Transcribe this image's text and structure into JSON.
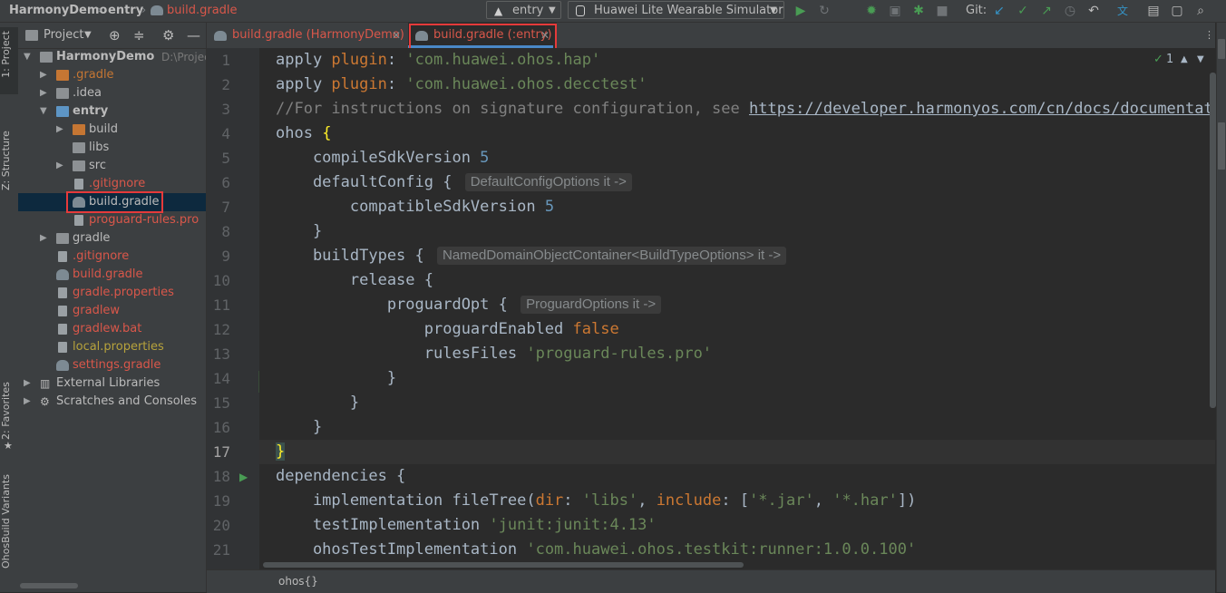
{
  "navbar": {
    "project": "HarmonyDemo",
    "module": "entry",
    "file": "build.gradle",
    "config_label": "entry",
    "device_label": "Huawei Lite Wearable Simulator",
    "git_label": "Git:"
  },
  "left_stripe": {
    "project_tab": "1: Project",
    "structure_tab": "Z: Structure",
    "favorites_tab": "2: Favorites",
    "build_variants_tab": "OhosBuild Variants"
  },
  "project_panel": {
    "title": "Project",
    "root_name": "HarmonyDemo",
    "root_path": "D:\\Project_",
    "items": [
      {
        "label": ".gradle"
      },
      {
        "label": ".idea"
      },
      {
        "label": "entry"
      },
      {
        "label": "build"
      },
      {
        "label": "libs"
      },
      {
        "label": "src"
      },
      {
        "label": ".gitignore"
      },
      {
        "label": "build.gradle"
      },
      {
        "label": "proguard-rules.pro"
      },
      {
        "label": "gradle"
      },
      {
        "label": ".gitignore"
      },
      {
        "label": "build.gradle"
      },
      {
        "label": "gradle.properties"
      },
      {
        "label": "gradlew"
      },
      {
        "label": "gradlew.bat"
      },
      {
        "label": "local.properties"
      },
      {
        "label": "settings.gradle"
      },
      {
        "label": "External Libraries"
      },
      {
        "label": "Scratches and Consoles"
      }
    ]
  },
  "tabs": [
    {
      "label": "build.gradle (HarmonyDemo)"
    },
    {
      "label": "build.gradle (:entry)"
    }
  ],
  "editor": {
    "inspection_count": "1",
    "line_numbers": [
      "1",
      "2",
      "3",
      "4",
      "5",
      "6",
      "7",
      "8",
      "9",
      "10",
      "11",
      "12",
      "13",
      "14",
      "15",
      "16",
      "17",
      "18",
      "19",
      "20",
      "21"
    ],
    "lines": {
      "l1": {
        "a": "apply ",
        "b": "plugin",
        "c": ": ",
        "d": "'com.huawei.ohos.hap'"
      },
      "l2": {
        "a": "apply ",
        "b": "plugin",
        "c": ": ",
        "d": "'com.huawei.ohos.decctest'"
      },
      "l3": {
        "a": "//For instructions on signature configuration, see ",
        "b": "https://developer.harmonyos.com/cn/docs/documentation"
      },
      "l4": {
        "a": "ohos ",
        "b": "{"
      },
      "l5": {
        "a": "    compileSdkVersion ",
        "b": "5"
      },
      "l6": {
        "a": "    defaultConfig { ",
        "hint": "DefaultConfigOptions it ->"
      },
      "l7": {
        "a": "        compatibleSdkVersion ",
        "b": "5"
      },
      "l8": {
        "a": "    }"
      },
      "l9": {
        "a": "    buildTypes { ",
        "hint": "NamedDomainObjectContainer<BuildTypeOptions> it ->"
      },
      "l10": {
        "a": "        release {"
      },
      "l11": {
        "a": "            proguardOpt { ",
        "hint": "ProguardOptions it ->"
      },
      "l12": {
        "a": "                proguardEnabled ",
        "b": "false"
      },
      "l13": {
        "a": "                rulesFiles ",
        "b": "'proguard-rules.pro'"
      },
      "l14": {
        "a": "            }"
      },
      "l15": {
        "a": "        }"
      },
      "l16": {
        "a": "    }"
      },
      "l17": {
        "a": "}"
      },
      "l18": {
        "a": "dependencies {"
      },
      "l19": {
        "a": "    implementation fileTree(",
        "b": "dir",
        "c": ": ",
        "d": "'libs'",
        "e": ", ",
        "f": "include",
        "g": ": [",
        "h": "'*.jar'",
        "i": ", ",
        "j": "'*.har'",
        "k": "])"
      },
      "l20": {
        "a": "    testImplementation ",
        "b": "'junit:junit:4.13'"
      },
      "l21": {
        "a": "    ohosTestImplementation ",
        "b": "'com.huawei.ohos.testkit:runner:1.0.0.100'"
      }
    },
    "breadcrumb": "ohos{}"
  },
  "colors": {
    "red_highlight": "#e53a3a",
    "selected_row": "#0d293e",
    "keyword": "#cc7832",
    "string": "#6a8759",
    "number": "#6897bb"
  }
}
